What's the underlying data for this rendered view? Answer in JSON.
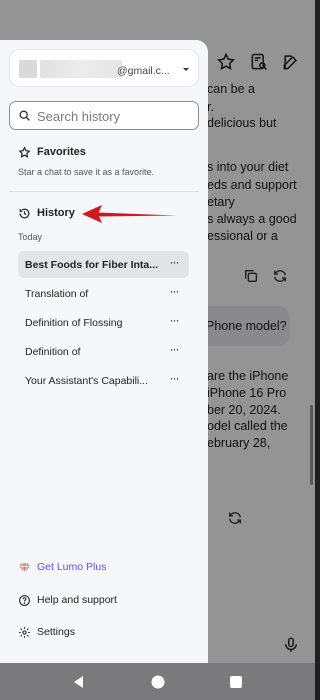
{
  "chat_background": {
    "lines": [
      "can be a",
      "r.",
      "delicious but",
      "",
      "s into your diet",
      "eds and support",
      "etary",
      "s always a good",
      "essional or a"
    ],
    "bubble_text": "Phone model?",
    "answer_lines": [
      "are the iPhone",
      "iPhone 16 Pro",
      "ber 20, 2024.",
      "odel called the",
      "ebruary 28,"
    ]
  },
  "drawer": {
    "account": {
      "email_suffix": "@gmail.c..."
    },
    "search": {
      "placeholder": "Search history"
    },
    "favorites": {
      "label": "Favorites",
      "description": "Star a chat to save it as a favorite."
    },
    "history": {
      "label": "History",
      "group_label": "Today",
      "items": [
        {
          "title": "Best Foods for Fiber Inta...",
          "more": "···"
        },
        {
          "title": "Translation of",
          "more": "···"
        },
        {
          "title": "Definition of Flossing",
          "more": "···"
        },
        {
          "title": "Definition of",
          "more": "···"
        },
        {
          "title": "Your Assistant's Capabili...",
          "more": "···"
        }
      ]
    },
    "footer": {
      "upgrade": "Get Lumo Plus",
      "help": "Help and support",
      "settings": "Settings"
    }
  },
  "colors": {
    "accent": "#6d4aff",
    "annotation_arrow": "#d0191f",
    "drawer_bg": "#f6f7fa"
  }
}
